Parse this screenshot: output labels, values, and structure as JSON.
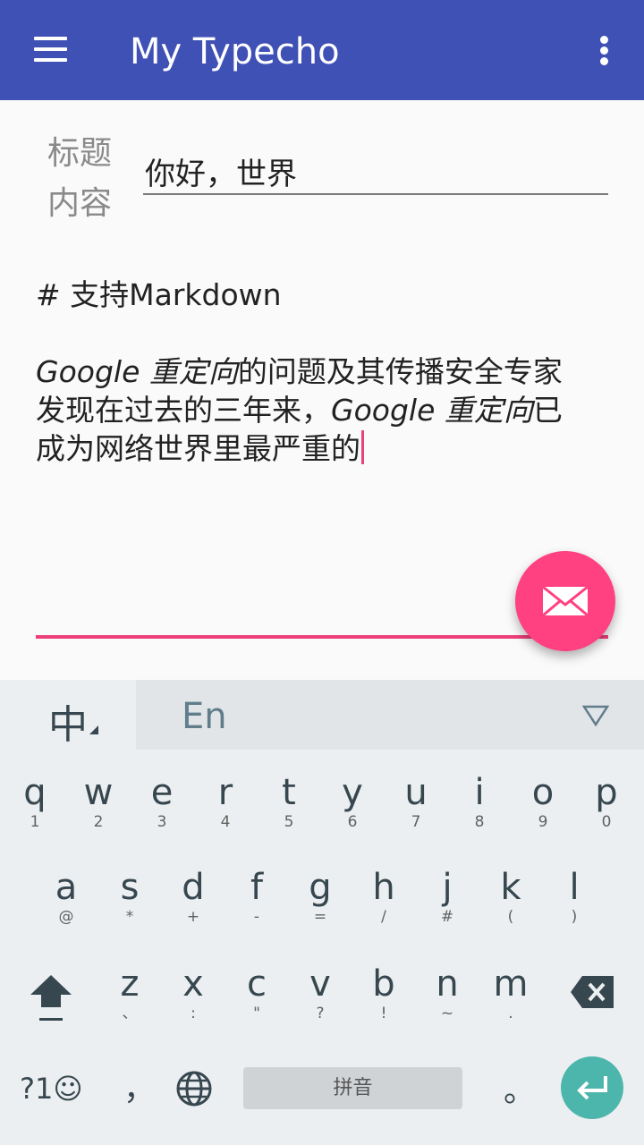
{
  "app_bar": {
    "title": "My Typecho",
    "menu_icon": "hamburger-menu-icon",
    "overflow_icon": "more-vert-icon",
    "color": "#3f51b5"
  },
  "form": {
    "title_label": "标题",
    "content_label": "内容",
    "title_value": "你好，世界",
    "content_heading": "# 支持Markdown",
    "content_line1_italic": "Google 重定向",
    "content_line1_rest": "的问题及其传播安全专家",
    "content_line2_start": "发现在过去的三年来，",
    "content_line2_italic": "Google 重定向",
    "content_line2_end": "已",
    "content_line3": "成为网络世界里最严重的",
    "accent_color": "#ec407a"
  },
  "fab": {
    "icon": "mail-icon",
    "color": "#ff4081"
  },
  "keyboard": {
    "lang_zh": "中",
    "lang_en": "En",
    "collapse_icon": "collapse-triangle-icon",
    "row1": [
      {
        "main": "q",
        "sub": "1"
      },
      {
        "main": "w",
        "sub": "2"
      },
      {
        "main": "e",
        "sub": "3"
      },
      {
        "main": "r",
        "sub": "4"
      },
      {
        "main": "t",
        "sub": "5"
      },
      {
        "main": "y",
        "sub": "6"
      },
      {
        "main": "u",
        "sub": "7"
      },
      {
        "main": "i",
        "sub": "8"
      },
      {
        "main": "o",
        "sub": "9"
      },
      {
        "main": "p",
        "sub": "0"
      }
    ],
    "row2": [
      {
        "main": "a",
        "sub": "@"
      },
      {
        "main": "s",
        "sub": "*"
      },
      {
        "main": "d",
        "sub": "+"
      },
      {
        "main": "f",
        "sub": "-"
      },
      {
        "main": "g",
        "sub": "="
      },
      {
        "main": "h",
        "sub": "/"
      },
      {
        "main": "j",
        "sub": "#"
      },
      {
        "main": "k",
        "sub": "("
      },
      {
        "main": "l",
        "sub": ")"
      }
    ],
    "row3": [
      {
        "main": "z",
        "sub": "、"
      },
      {
        "main": "x",
        "sub": ":"
      },
      {
        "main": "c",
        "sub": "\""
      },
      {
        "main": "v",
        "sub": "?"
      },
      {
        "main": "b",
        "sub": "!"
      },
      {
        "main": "n",
        "sub": "~"
      },
      {
        "main": "m",
        "sub": "."
      }
    ],
    "shift_icon": "shift-icon",
    "backspace_icon": "backspace-icon",
    "symbols_label": "?1☺",
    "comma": "，",
    "globe_icon": "globe-icon",
    "space_label": "拼音",
    "period": "。",
    "enter_icon": "enter-icon",
    "enter_color": "#4db6ac"
  }
}
